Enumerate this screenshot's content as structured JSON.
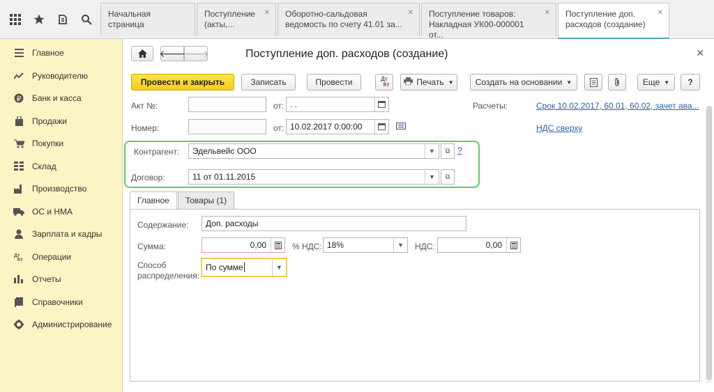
{
  "tabs": [
    {
      "line1": "Начальная страница",
      "line2": ""
    },
    {
      "line1": "Поступление",
      "line2": "(акты,..."
    },
    {
      "line1": "Оборотно-сальдовая",
      "line2": "ведомость по счету 41.01 за..."
    },
    {
      "line1": "Поступление товаров:",
      "line2": "Накладная УК00-000001 от..."
    },
    {
      "line1": "Поступление доп.",
      "line2": "расходов (создание)"
    }
  ],
  "sidebar": [
    {
      "label": "Главное",
      "icon": "menu-icon"
    },
    {
      "label": "Руководителю",
      "icon": "chart-line-icon"
    },
    {
      "label": "Банк и касса",
      "icon": "ruble-coin-icon"
    },
    {
      "label": "Продажи",
      "icon": "shopping-bag-icon"
    },
    {
      "label": "Покупки",
      "icon": "cart-icon"
    },
    {
      "label": "Склад",
      "icon": "grid-icon"
    },
    {
      "label": "Производство",
      "icon": "factory-icon"
    },
    {
      "label": "ОС и НМА",
      "icon": "truck-icon"
    },
    {
      "label": "Зарплата и кадры",
      "icon": "person-icon"
    },
    {
      "label": "Операции",
      "icon": "dt-kt-icon"
    },
    {
      "label": "Отчеты",
      "icon": "bar-chart-icon"
    },
    {
      "label": "Справочники",
      "icon": "book-icon"
    },
    {
      "label": "Администрирование",
      "icon": "gear-icon"
    }
  ],
  "form": {
    "title": "Поступление доп. расходов (создание)",
    "toolbar": {
      "post_close": "Провести и закрыть",
      "save": "Записать",
      "post": "Провести",
      "dtkt_top": "Дт",
      "dtkt_bottom": "Кт",
      "print": "Печать",
      "create_based": "Создать на основании",
      "more": "Еще",
      "help": "?"
    },
    "act_label": "Акт №:",
    "act_value": "",
    "from_label": "от:",
    "act_date": " .  .",
    "number_label": "Номер:",
    "number_value": "",
    "from_label2": "от:",
    "date_value": "10.02.2017  0:00:00",
    "settlements_label": "Расчеты:",
    "settlements_link": "Срок 10.02.2017, 60.01, 60.02, зачет ава...",
    "vat_link": "НДС сверху",
    "counterparty_label": "Контрагент:",
    "counterparty_value": "Эдельвейс ООО",
    "question": "?",
    "contract_label": "Договор:",
    "contract_value": "11 от 01.11.2015",
    "tabs": [
      "Главное",
      "Товары (1)"
    ],
    "content_label": "Содержание:",
    "content_value": "Доп. расходы",
    "sum_label": "Сумма:",
    "sum_value": "0,00",
    "vat_pct_label": "% НДС:",
    "vat_pct_value": "18%",
    "vat_label": "НДС:",
    "vat_value": "0,00",
    "dist_label1": "Способ",
    "dist_label2": "распределения:",
    "dist_value": "По сумме"
  }
}
